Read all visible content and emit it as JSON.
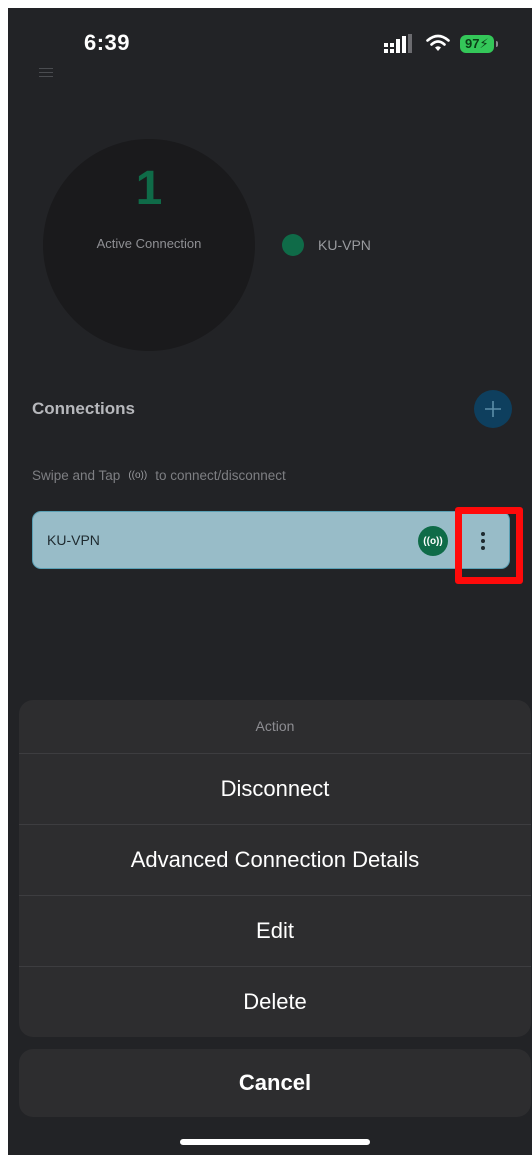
{
  "status_bar": {
    "time": "6:39",
    "battery": "97",
    "icons": [
      "signal-icon",
      "wifi-icon",
      "battery-charging-icon"
    ]
  },
  "header": {
    "menu_icon": "menu-icon"
  },
  "summary": {
    "active_count": "1",
    "active_label": "Active Connection",
    "legend": [
      {
        "label": "KU-VPN",
        "color": "#0f6b48"
      }
    ]
  },
  "connections": {
    "title": "Connections",
    "add_icon": "plus-icon",
    "hint_prefix": "Swipe and Tap",
    "hint_icon": "((o))",
    "hint_suffix": "to connect/disconnect",
    "items": [
      {
        "name": "KU-VPN",
        "toggle_icon": "((o))",
        "menu_icon": "more-vertical-icon"
      }
    ]
  },
  "action_sheet": {
    "title": "Action",
    "options": [
      "Disconnect",
      "Advanced Connection Details",
      "Edit",
      "Delete"
    ],
    "cancel": "Cancel"
  },
  "colors": {
    "background": "#222326",
    "accent_green": "#0f6b48",
    "accent_blue": "#0e3f5e",
    "card": "#98bcc8",
    "highlight": "#ff0a0a",
    "sheet": "#2d2d2f"
  }
}
